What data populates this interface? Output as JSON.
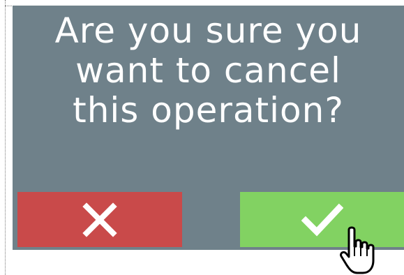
{
  "dialog": {
    "message_lines": [
      "Are you sure you",
      "want to cancel",
      "this operation?"
    ],
    "background_color": "#6f818a"
  },
  "buttons": {
    "cancel": {
      "icon": "close-icon",
      "color": "#c94a4a"
    },
    "confirm": {
      "icon": "checkmark-icon",
      "color": "#82d262"
    }
  },
  "cursor": {
    "icon": "hand-pointer-icon"
  }
}
